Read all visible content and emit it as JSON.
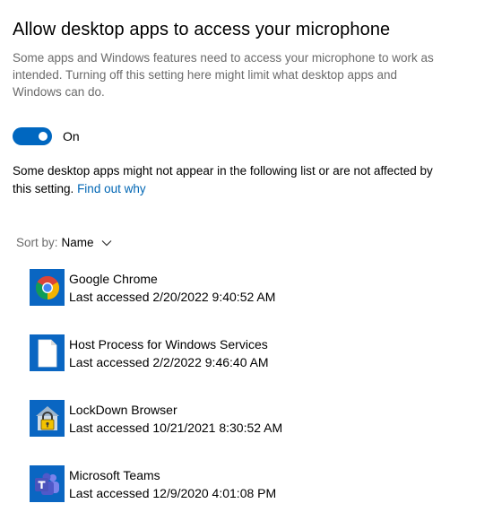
{
  "header": {
    "title": "Allow desktop apps to access your microphone",
    "description": "Some apps and Windows features need to access your microphone to work as intended. Turning off this setting here might limit what desktop apps and Windows can do."
  },
  "toggle": {
    "state_label": "On",
    "on": true
  },
  "note": {
    "text": "Some desktop apps might not appear in the following list or are not affected by this setting.",
    "link_label": "Find out why"
  },
  "sort": {
    "label": "Sort by:",
    "value": "Name"
  },
  "apps": [
    {
      "name": "Google Chrome",
      "access": "Last accessed 2/20/2022 9:40:52 AM",
      "icon": "chrome-icon"
    },
    {
      "name": "Host Process for Windows Services",
      "access": "Last accessed 2/2/2022 9:46:40 AM",
      "icon": "document-icon"
    },
    {
      "name": "LockDown Browser",
      "access": "Last accessed 10/21/2021 8:30:52 AM",
      "icon": "lock-icon"
    },
    {
      "name": "Microsoft Teams",
      "access": "Last accessed 12/9/2020 4:01:08 PM",
      "icon": "teams-icon"
    }
  ],
  "colors": {
    "accent": "#0067c0",
    "icon_tile": "#0a66c2",
    "link": "#0066b4",
    "secondary_text": "#6b6b6b"
  }
}
